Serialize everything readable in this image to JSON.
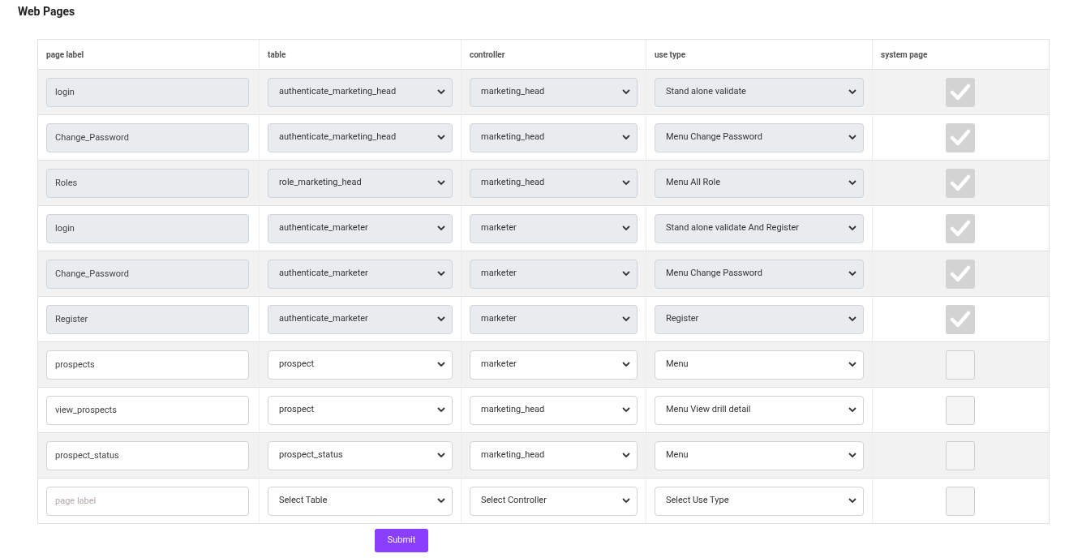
{
  "title": "Web Pages",
  "columns": [
    "page label",
    "table",
    "controller",
    "use type",
    "system page"
  ],
  "rows": [
    {
      "page_label": {
        "value": "login"
      },
      "table": {
        "value": "authenticate_marketing_head"
      },
      "controller": {
        "value": "marketing_head"
      },
      "use_type": {
        "value": "Stand alone validate"
      },
      "disabled": true,
      "system_page": true
    },
    {
      "page_label": {
        "value": "Change_Password"
      },
      "table": {
        "value": "authenticate_marketing_head"
      },
      "controller": {
        "value": "marketing_head"
      },
      "use_type": {
        "value": "Menu Change Password"
      },
      "disabled": true,
      "system_page": true
    },
    {
      "page_label": {
        "value": "Roles"
      },
      "table": {
        "value": "role_marketing_head"
      },
      "controller": {
        "value": "marketing_head"
      },
      "use_type": {
        "value": "Menu All Role"
      },
      "disabled": true,
      "system_page": true
    },
    {
      "page_label": {
        "value": "login"
      },
      "table": {
        "value": "authenticate_marketer"
      },
      "controller": {
        "value": "marketer"
      },
      "use_type": {
        "value": "Stand alone validate And Register"
      },
      "disabled": true,
      "system_page": true
    },
    {
      "page_label": {
        "value": "Change_Password"
      },
      "table": {
        "value": "authenticate_marketer"
      },
      "controller": {
        "value": "marketer"
      },
      "use_type": {
        "value": "Menu Change Password"
      },
      "disabled": true,
      "system_page": true
    },
    {
      "page_label": {
        "value": "Register"
      },
      "table": {
        "value": "authenticate_marketer"
      },
      "controller": {
        "value": "marketer"
      },
      "use_type": {
        "value": "Register"
      },
      "disabled": true,
      "system_page": true
    },
    {
      "page_label": {
        "value": "prospects"
      },
      "table": {
        "value": "prospect"
      },
      "controller": {
        "value": "marketer"
      },
      "use_type": {
        "value": "Menu"
      },
      "disabled": false,
      "system_page": false
    },
    {
      "page_label": {
        "value": "view_prospects"
      },
      "table": {
        "value": "prospect"
      },
      "controller": {
        "value": "marketing_head"
      },
      "use_type": {
        "value": "Menu View drill detail"
      },
      "disabled": false,
      "system_page": false
    },
    {
      "page_label": {
        "value": "prospect_status"
      },
      "table": {
        "value": "prospect_status"
      },
      "controller": {
        "value": "marketing_head"
      },
      "use_type": {
        "value": "Menu"
      },
      "disabled": false,
      "system_page": false
    },
    {
      "page_label": {
        "placeholder": "page label"
      },
      "table": {
        "placeholder": "Select Table"
      },
      "controller": {
        "placeholder": "Select Controller"
      },
      "use_type": {
        "placeholder": "Select Use Type"
      },
      "disabled": false,
      "system_page": false
    }
  ],
  "submit": "Submit"
}
